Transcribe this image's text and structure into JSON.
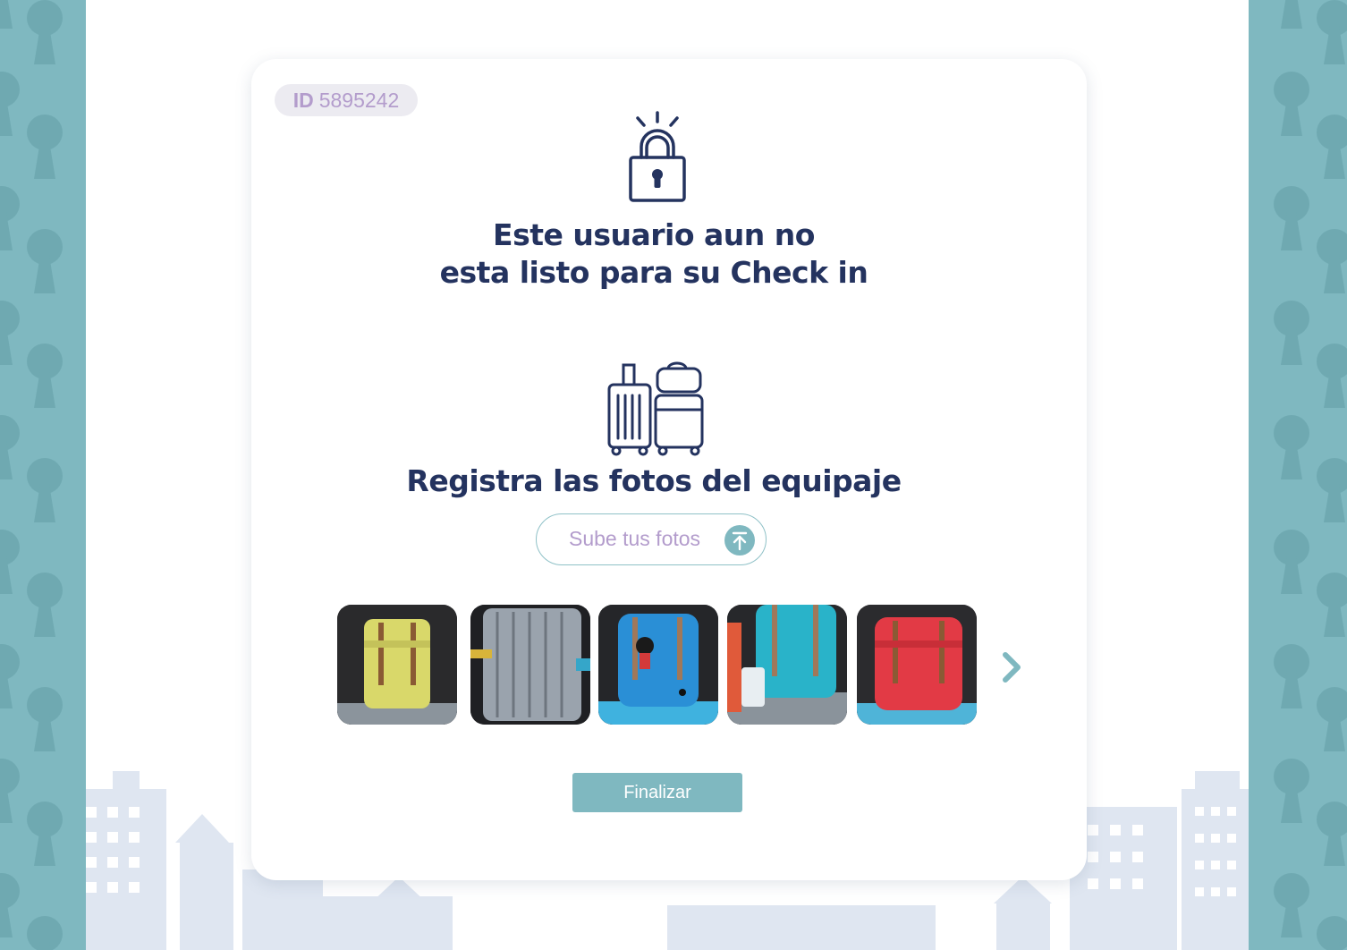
{
  "badge": {
    "label": "ID",
    "value": "5895242"
  },
  "title": {
    "line1": "Este usuario aun no",
    "line2": "esta listo para su Check in"
  },
  "luggage_section": {
    "heading": "Registra las fotos del equipaje"
  },
  "upload": {
    "label": "Sube tus fotos",
    "icon": "upload-arrow-icon"
  },
  "photos": [
    {
      "alt": "yellow backpack on suitcase",
      "bag_color": "#d9d86a"
    },
    {
      "alt": "silver suitcase",
      "bag_color": "#9aa3ad"
    },
    {
      "alt": "blue backpack with keychain",
      "bag_color": "#2a8fd6"
    },
    {
      "alt": "teal backpack on suitcase",
      "bag_color": "#29b3c9"
    },
    {
      "alt": "red backpack on suitcase",
      "bag_color": "#e23a45"
    }
  ],
  "gallery": {
    "next_icon": "chevron-right-icon"
  },
  "finish": {
    "label": "Finalizar"
  },
  "colors": {
    "navy": "#24335f",
    "teal": "#7fb8c0",
    "lavender": "#b39ccc"
  }
}
